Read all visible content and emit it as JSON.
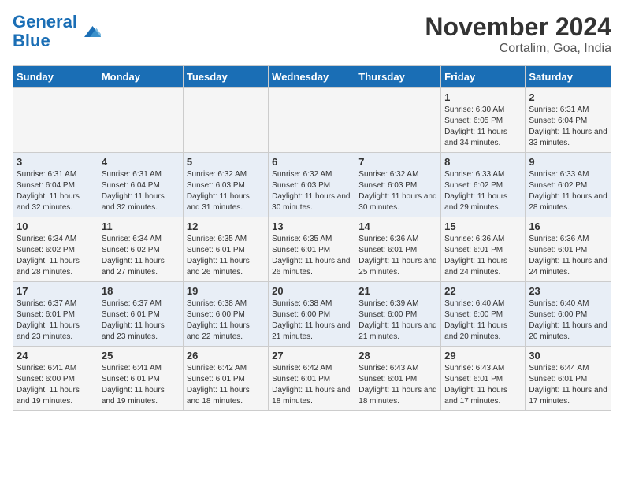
{
  "logo": {
    "text_general": "General",
    "text_blue": "Blue"
  },
  "header": {
    "title": "November 2024",
    "subtitle": "Cortalim, Goa, India"
  },
  "days_of_week": [
    "Sunday",
    "Monday",
    "Tuesday",
    "Wednesday",
    "Thursday",
    "Friday",
    "Saturday"
  ],
  "weeks": [
    [
      {
        "day": "",
        "info": ""
      },
      {
        "day": "",
        "info": ""
      },
      {
        "day": "",
        "info": ""
      },
      {
        "day": "",
        "info": ""
      },
      {
        "day": "",
        "info": ""
      },
      {
        "day": "1",
        "info": "Sunrise: 6:30 AM\nSunset: 6:05 PM\nDaylight: 11 hours and 34 minutes."
      },
      {
        "day": "2",
        "info": "Sunrise: 6:31 AM\nSunset: 6:04 PM\nDaylight: 11 hours and 33 minutes."
      }
    ],
    [
      {
        "day": "3",
        "info": "Sunrise: 6:31 AM\nSunset: 6:04 PM\nDaylight: 11 hours and 32 minutes."
      },
      {
        "day": "4",
        "info": "Sunrise: 6:31 AM\nSunset: 6:04 PM\nDaylight: 11 hours and 32 minutes."
      },
      {
        "day": "5",
        "info": "Sunrise: 6:32 AM\nSunset: 6:03 PM\nDaylight: 11 hours and 31 minutes."
      },
      {
        "day": "6",
        "info": "Sunrise: 6:32 AM\nSunset: 6:03 PM\nDaylight: 11 hours and 30 minutes."
      },
      {
        "day": "7",
        "info": "Sunrise: 6:32 AM\nSunset: 6:03 PM\nDaylight: 11 hours and 30 minutes."
      },
      {
        "day": "8",
        "info": "Sunrise: 6:33 AM\nSunset: 6:02 PM\nDaylight: 11 hours and 29 minutes."
      },
      {
        "day": "9",
        "info": "Sunrise: 6:33 AM\nSunset: 6:02 PM\nDaylight: 11 hours and 28 minutes."
      }
    ],
    [
      {
        "day": "10",
        "info": "Sunrise: 6:34 AM\nSunset: 6:02 PM\nDaylight: 11 hours and 28 minutes."
      },
      {
        "day": "11",
        "info": "Sunrise: 6:34 AM\nSunset: 6:02 PM\nDaylight: 11 hours and 27 minutes."
      },
      {
        "day": "12",
        "info": "Sunrise: 6:35 AM\nSunset: 6:01 PM\nDaylight: 11 hours and 26 minutes."
      },
      {
        "day": "13",
        "info": "Sunrise: 6:35 AM\nSunset: 6:01 PM\nDaylight: 11 hours and 26 minutes."
      },
      {
        "day": "14",
        "info": "Sunrise: 6:36 AM\nSunset: 6:01 PM\nDaylight: 11 hours and 25 minutes."
      },
      {
        "day": "15",
        "info": "Sunrise: 6:36 AM\nSunset: 6:01 PM\nDaylight: 11 hours and 24 minutes."
      },
      {
        "day": "16",
        "info": "Sunrise: 6:36 AM\nSunset: 6:01 PM\nDaylight: 11 hours and 24 minutes."
      }
    ],
    [
      {
        "day": "17",
        "info": "Sunrise: 6:37 AM\nSunset: 6:01 PM\nDaylight: 11 hours and 23 minutes."
      },
      {
        "day": "18",
        "info": "Sunrise: 6:37 AM\nSunset: 6:01 PM\nDaylight: 11 hours and 23 minutes."
      },
      {
        "day": "19",
        "info": "Sunrise: 6:38 AM\nSunset: 6:00 PM\nDaylight: 11 hours and 22 minutes."
      },
      {
        "day": "20",
        "info": "Sunrise: 6:38 AM\nSunset: 6:00 PM\nDaylight: 11 hours and 21 minutes."
      },
      {
        "day": "21",
        "info": "Sunrise: 6:39 AM\nSunset: 6:00 PM\nDaylight: 11 hours and 21 minutes."
      },
      {
        "day": "22",
        "info": "Sunrise: 6:40 AM\nSunset: 6:00 PM\nDaylight: 11 hours and 20 minutes."
      },
      {
        "day": "23",
        "info": "Sunrise: 6:40 AM\nSunset: 6:00 PM\nDaylight: 11 hours and 20 minutes."
      }
    ],
    [
      {
        "day": "24",
        "info": "Sunrise: 6:41 AM\nSunset: 6:00 PM\nDaylight: 11 hours and 19 minutes."
      },
      {
        "day": "25",
        "info": "Sunrise: 6:41 AM\nSunset: 6:01 PM\nDaylight: 11 hours and 19 minutes."
      },
      {
        "day": "26",
        "info": "Sunrise: 6:42 AM\nSunset: 6:01 PM\nDaylight: 11 hours and 18 minutes."
      },
      {
        "day": "27",
        "info": "Sunrise: 6:42 AM\nSunset: 6:01 PM\nDaylight: 11 hours and 18 minutes."
      },
      {
        "day": "28",
        "info": "Sunrise: 6:43 AM\nSunset: 6:01 PM\nDaylight: 11 hours and 18 minutes."
      },
      {
        "day": "29",
        "info": "Sunrise: 6:43 AM\nSunset: 6:01 PM\nDaylight: 11 hours and 17 minutes."
      },
      {
        "day": "30",
        "info": "Sunrise: 6:44 AM\nSunset: 6:01 PM\nDaylight: 11 hours and 17 minutes."
      }
    ]
  ]
}
